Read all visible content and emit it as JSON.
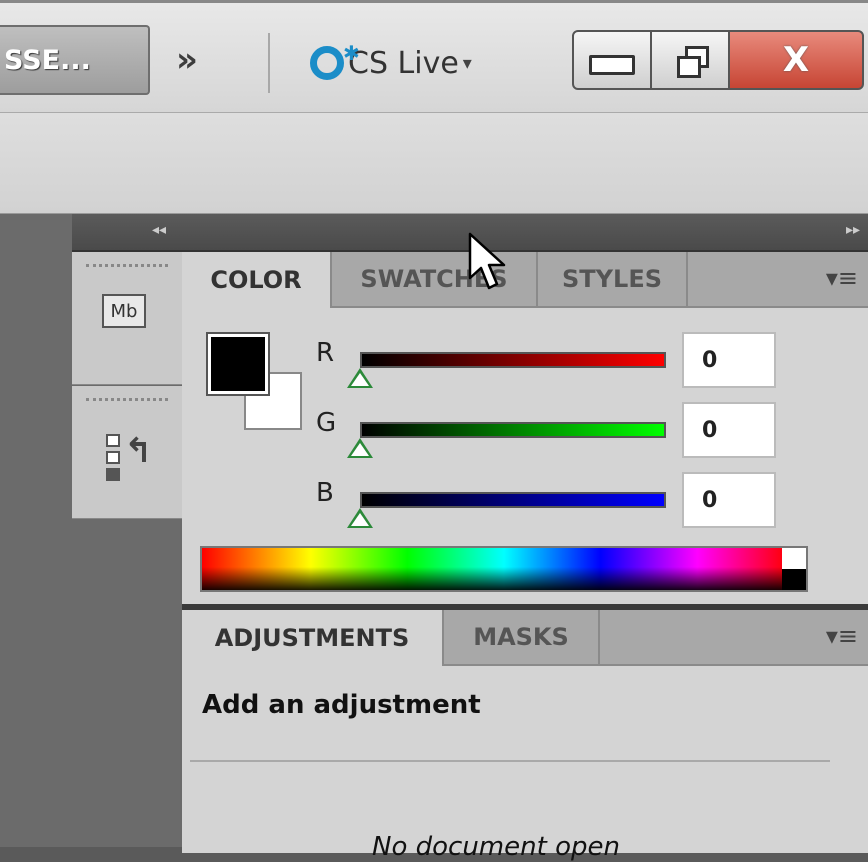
{
  "titlebar": {
    "workspace_label": "SSE...",
    "more_glyph": "»",
    "cs_live_label": "CS Live",
    "cs_live_caret": "▾",
    "close_glyph": "X"
  },
  "dock": {
    "mini_bridge_label": "Mb",
    "history_arrow": "↰"
  },
  "panel_strip": {
    "collapse_left": "◂◂",
    "collapse_right": "▸▸"
  },
  "color_panel": {
    "tabs": [
      "COLOR",
      "SWATCHES",
      "STYLES"
    ],
    "active_tab": "COLOR",
    "menu_icon": "▾≡",
    "foreground_color": "#000000",
    "background_color": "#ffffff",
    "channels": [
      {
        "label": "R",
        "value": "0",
        "gradient_end": "#ff0000",
        "level": 0
      },
      {
        "label": "G",
        "value": "0",
        "gradient_end": "#00ff00",
        "level": 0
      },
      {
        "label": "B",
        "value": "0",
        "gradient_end": "#0000ff",
        "level": 0
      }
    ]
  },
  "adjustments_panel": {
    "tabs": [
      "ADJUSTMENTS",
      "MASKS"
    ],
    "active_tab": "ADJUSTMENTS",
    "menu_icon": "▾≡",
    "heading": "Add an adjustment",
    "status": "No document open"
  },
  "colors": {
    "cs_live_blue": "#1b8dc8",
    "close_red": "#c74534",
    "slider_thumb": "#2c8a3a"
  }
}
